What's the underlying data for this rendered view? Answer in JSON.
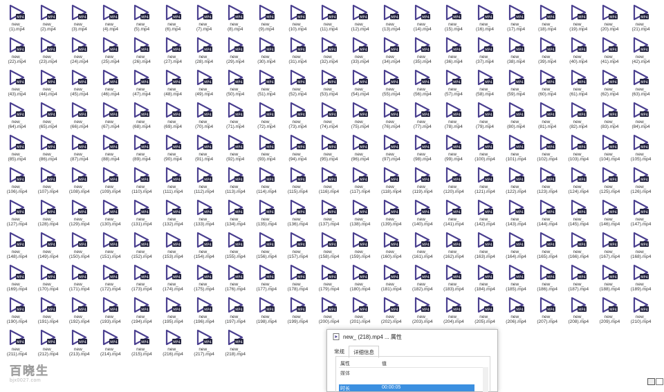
{
  "files": [
    "(1).mp4",
    "(2).mp4",
    "(3).mp4",
    "(4).mp4",
    "(5).mp4",
    "(6).mp4",
    "(7).mp4",
    "(8).mp4",
    "(9).mp4",
    "(10).mp4",
    "(11).mp4",
    "(12).mp4",
    "(13).mp4",
    "(14).mp4",
    "(15).mp4",
    "(16).mp4",
    "(17).mp4",
    "(18).mp4",
    "(19).mp4",
    "(20).mp4",
    "(21).mp4",
    "(22).mp4",
    "(23).mp4",
    "(24).mp4",
    "(25).mp4",
    "(26).mp4",
    "(27).mp4",
    "(28).mp4",
    "(29).mp4",
    "(30).mp4",
    "(31).mp4",
    "(32).mp4",
    "(33).mp4",
    "(34).mp4",
    "(35).mp4",
    "(36).mp4",
    "(37).mp4",
    "(38).mp4",
    "(39).mp4",
    "(40).mp4",
    "(41).mp4",
    "(42).mp4",
    "(43).mp4",
    "(44).mp4",
    "(45).mp4",
    "(46).mp4",
    "(47).mp4",
    "(48).mp4",
    "(49).mp4",
    "(50).mp4",
    "(51).mp4",
    "(52).mp4",
    "(53).mp4",
    "(54).mp4",
    "(55).mp4",
    "(56).mp4",
    "(57).mp4",
    "(58).mp4",
    "(59).mp4",
    "(60).mp4",
    "(61).mp4",
    "(62).mp4",
    "(63).mp4",
    "(64).mp4",
    "(65).mp4",
    "(66).mp4",
    "(67).mp4",
    "(68).mp4",
    "(69).mp4",
    "(70).mp4",
    "(71).mp4",
    "(72).mp4",
    "(73).mp4",
    "(74).mp4",
    "(75).mp4",
    "(76).mp4",
    "(77).mp4",
    "(78).mp4",
    "(79).mp4",
    "(80).mp4",
    "(81).mp4",
    "(82).mp4",
    "(83).mp4",
    "(84).mp4",
    "(85).mp4",
    "(86).mp4",
    "(87).mp4",
    "(88).mp4",
    "(89).mp4",
    "(90).mp4",
    "(91).mp4",
    "(92).mp4",
    "(93).mp4",
    "(94).mp4",
    "(95).mp4",
    "(96).mp4",
    "(97).mp4",
    "(98).mp4",
    "(99).mp4",
    "(100).mp4",
    "(101).mp4",
    "(102).mp4",
    "(103).mp4",
    "(104).mp4",
    "(105).mp4",
    "(106).mp4",
    "(107).mp4",
    "(108).mp4",
    "(109).mp4",
    "(110).mp4",
    "(111).mp4",
    "(112).mp4",
    "(113).mp4",
    "(114).mp4",
    "(115).mp4",
    "(116).mp4",
    "(117).mp4",
    "(118).mp4",
    "(119).mp4",
    "(120).mp4",
    "(121).mp4",
    "(122).mp4",
    "(123).mp4",
    "(124).mp4",
    "(125).mp4",
    "(126).mp4",
    "(127).mp4",
    "(128).mp4",
    "(129).mp4",
    "(130).mp4",
    "(131).mp4",
    "(132).mp4",
    "(133).mp4",
    "(134).mp4",
    "(135).mp4",
    "(136).mp4",
    "(137).mp4",
    "(138).mp4",
    "(139).mp4",
    "(140).mp4",
    "(141).mp4",
    "(142).mp4",
    "(143).mp4",
    "(144).mp4",
    "(145).mp4",
    "(146).mp4",
    "(147).mp4",
    "(148).mp4",
    "(149).mp4",
    "(150).mp4",
    "(151).mp4",
    "(152).mp4",
    "(153).mp4",
    "(154).mp4",
    "(155).mp4",
    "(156).mp4",
    "(157).mp4",
    "(158).mp4",
    "(159).mp4",
    "(160).mp4",
    "(161).mp4",
    "(162).mp4",
    "(163).mp4",
    "(164).mp4",
    "(165).mp4",
    "(166).mp4",
    "(167).mp4",
    "(168).mp4",
    "(169).mp4",
    "(170).mp4",
    "(171).mp4",
    "(172).mp4",
    "(173).mp4",
    "(174).mp4",
    "(175).mp4",
    "(176).mp4",
    "(177).mp4",
    "(178).mp4",
    "(179).mp4",
    "(180).mp4",
    "(181).mp4",
    "(182).mp4",
    "(183).mp4",
    "(184).mp4",
    "(185).mp4",
    "(186).mp4",
    "(187).mp4",
    "(188).mp4",
    "(189).mp4",
    "(190).mp4",
    "(191).mp4",
    "(192).mp4",
    "(193).mp4",
    "(194).mp4",
    "(195).mp4",
    "(196).mp4",
    "(197).mp4",
    "(198).mp4",
    "(199).mp4",
    "(200).mp4",
    "(201).mp4",
    "(202).mp4",
    "(203).mp4",
    "(204).mp4",
    "(205).mp4",
    "(206).mp4",
    "(207).mp4",
    "(208).mp4",
    "(209).mp4",
    "(210).mp4",
    "(211).mp4",
    "(212).mp4",
    "(213).mp4",
    "(214).mp4",
    "(215).mp4",
    "(216).mp4",
    "(217).mp4",
    "(218).mp4"
  ],
  "file_prefix": "new_",
  "icon_badge": "MP4",
  "colors": {
    "icon_accent": "#4a3f8f",
    "badge_bg": "#1f1f3a",
    "selection": "#3b8fe0"
  },
  "properties_dialog": {
    "title": "new_ (218).mp4 ... 属性",
    "tabs": [
      "常规",
      "详细信息"
    ],
    "active_tab": "详细信息",
    "header": {
      "property": "属性",
      "value": "值"
    },
    "rows": [
      {
        "name": "媒体",
        "value": ""
      },
      {
        "name": "时长",
        "value": "00:00:05"
      }
    ]
  },
  "watermark": {
    "text": "百晓生",
    "url": "bjx0027.com"
  }
}
